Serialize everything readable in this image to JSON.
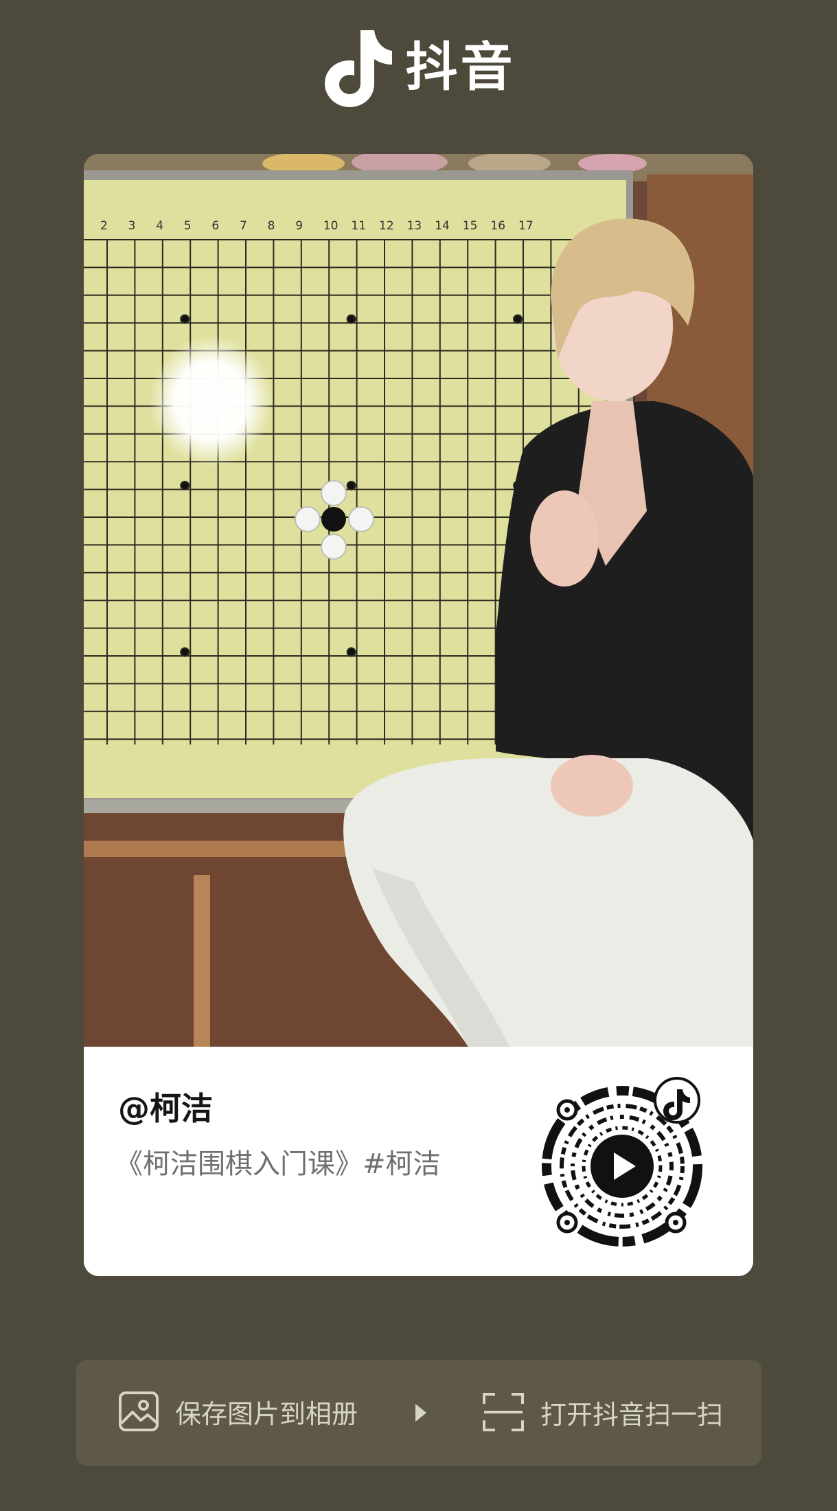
{
  "brand": {
    "name": "抖音",
    "icon": "douyin-note-icon"
  },
  "card": {
    "author": "@柯洁",
    "description": "《柯洁围棋入门课》#柯洁",
    "qr_icon": "douyin-qr-code-icon",
    "board_numbers": [
      "2",
      "3",
      "4",
      "5",
      "6",
      "7",
      "8",
      "9",
      "10",
      "11",
      "12",
      "13",
      "14",
      "15",
      "16",
      "17"
    ]
  },
  "actions": {
    "save_label": "保存图片到相册",
    "save_icon": "image-icon",
    "separator_icon": "play-triangle-icon",
    "scan_label": "打开抖音扫一扫",
    "scan_icon": "scan-icon"
  },
  "colors": {
    "background": "#4e4a3b",
    "action_bar": "#5d5848",
    "card": "#ffffff",
    "board": "#dfe09a"
  }
}
